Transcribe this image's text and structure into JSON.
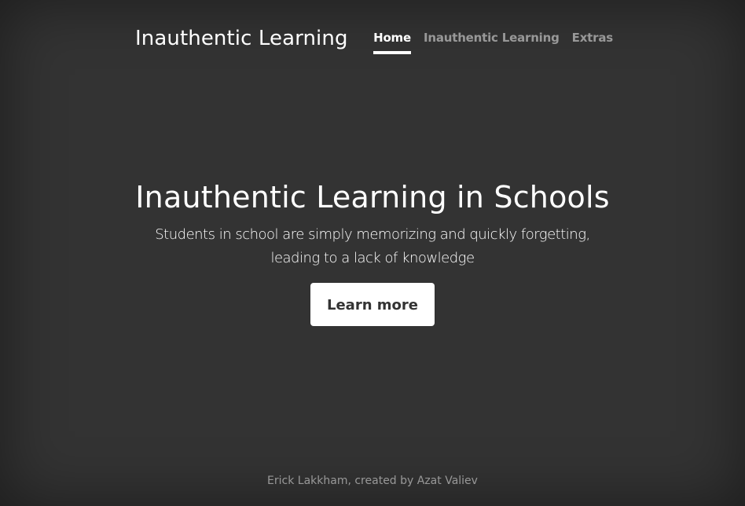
{
  "header": {
    "brand": "Inauthentic Learning",
    "nav": [
      {
        "label": "Home",
        "active": true
      },
      {
        "label": "Inauthentic Learning",
        "active": false
      },
      {
        "label": "Extras",
        "active": false
      }
    ]
  },
  "main": {
    "heading": "Inauthentic Learning in Schools",
    "lead": "Students in school are simply memorizing and quickly forgetting, leading to a lack of knowledge",
    "button_label": "Learn more"
  },
  "footer": {
    "text": "Erick Lakkham, created by Azat Valiev"
  },
  "colors": {
    "background": "#333333",
    "text": "#ffffff",
    "nav_inactive": "rgba(255,255,255,0.5)",
    "button_bg": "#ffffff",
    "button_text": "#333333"
  }
}
